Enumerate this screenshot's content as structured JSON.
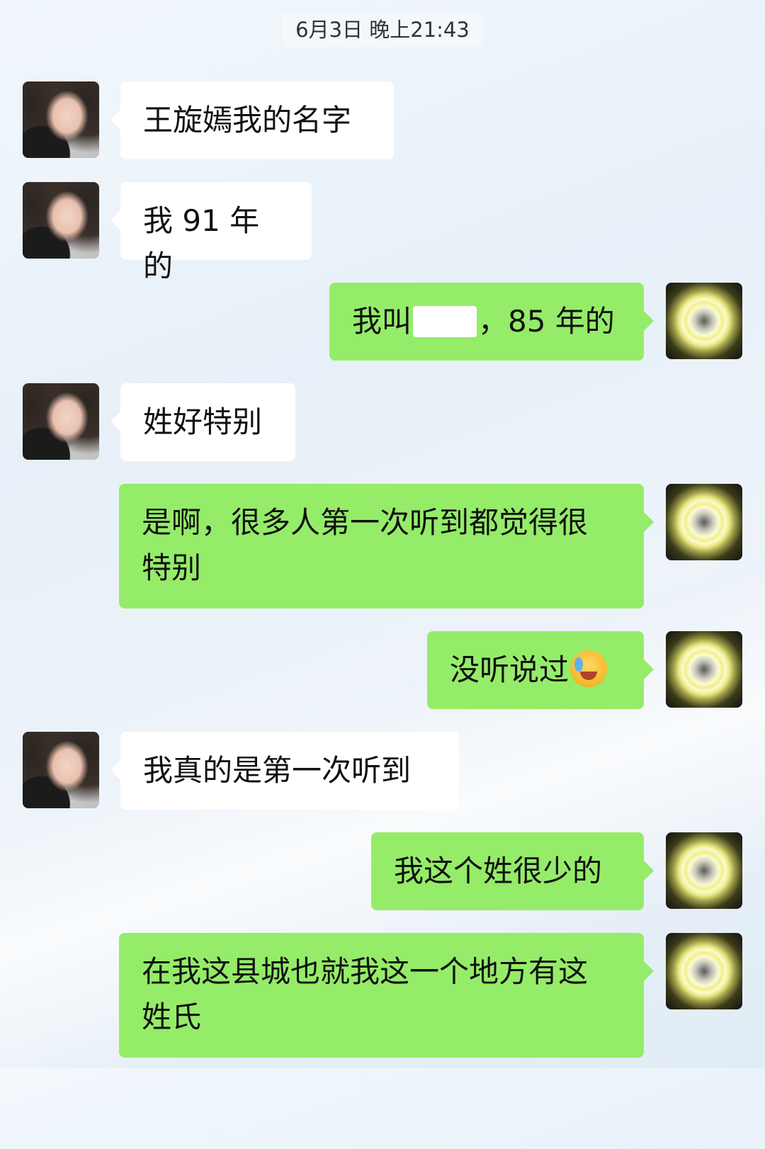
{
  "timestamp": "6月3日 晚上21:43",
  "messages": [
    {
      "sender": "contact",
      "text": "王旋嫣我的名字"
    },
    {
      "sender": "contact",
      "text": "我 91 年的"
    },
    {
      "sender": "me",
      "text_before": "我叫",
      "text_after": "，85 年的",
      "redacted": true
    },
    {
      "sender": "contact",
      "text": "姓好特别"
    },
    {
      "sender": "me",
      "line1": "是啊，很多人第一次听到都觉得很",
      "line2": "特别"
    },
    {
      "sender": "me",
      "text": "没听说过",
      "emoji": "facepalm-crying-emoji"
    },
    {
      "sender": "contact",
      "text": "我真的是第一次听到"
    },
    {
      "sender": "me",
      "text": "我这个姓很少的"
    },
    {
      "sender": "me",
      "line1": "在我这县城也就我这一个地方有这",
      "line2": "姓氏"
    }
  ],
  "colors": {
    "sent_bubble": "#95ec69",
    "received_bubble": "#ffffff"
  }
}
